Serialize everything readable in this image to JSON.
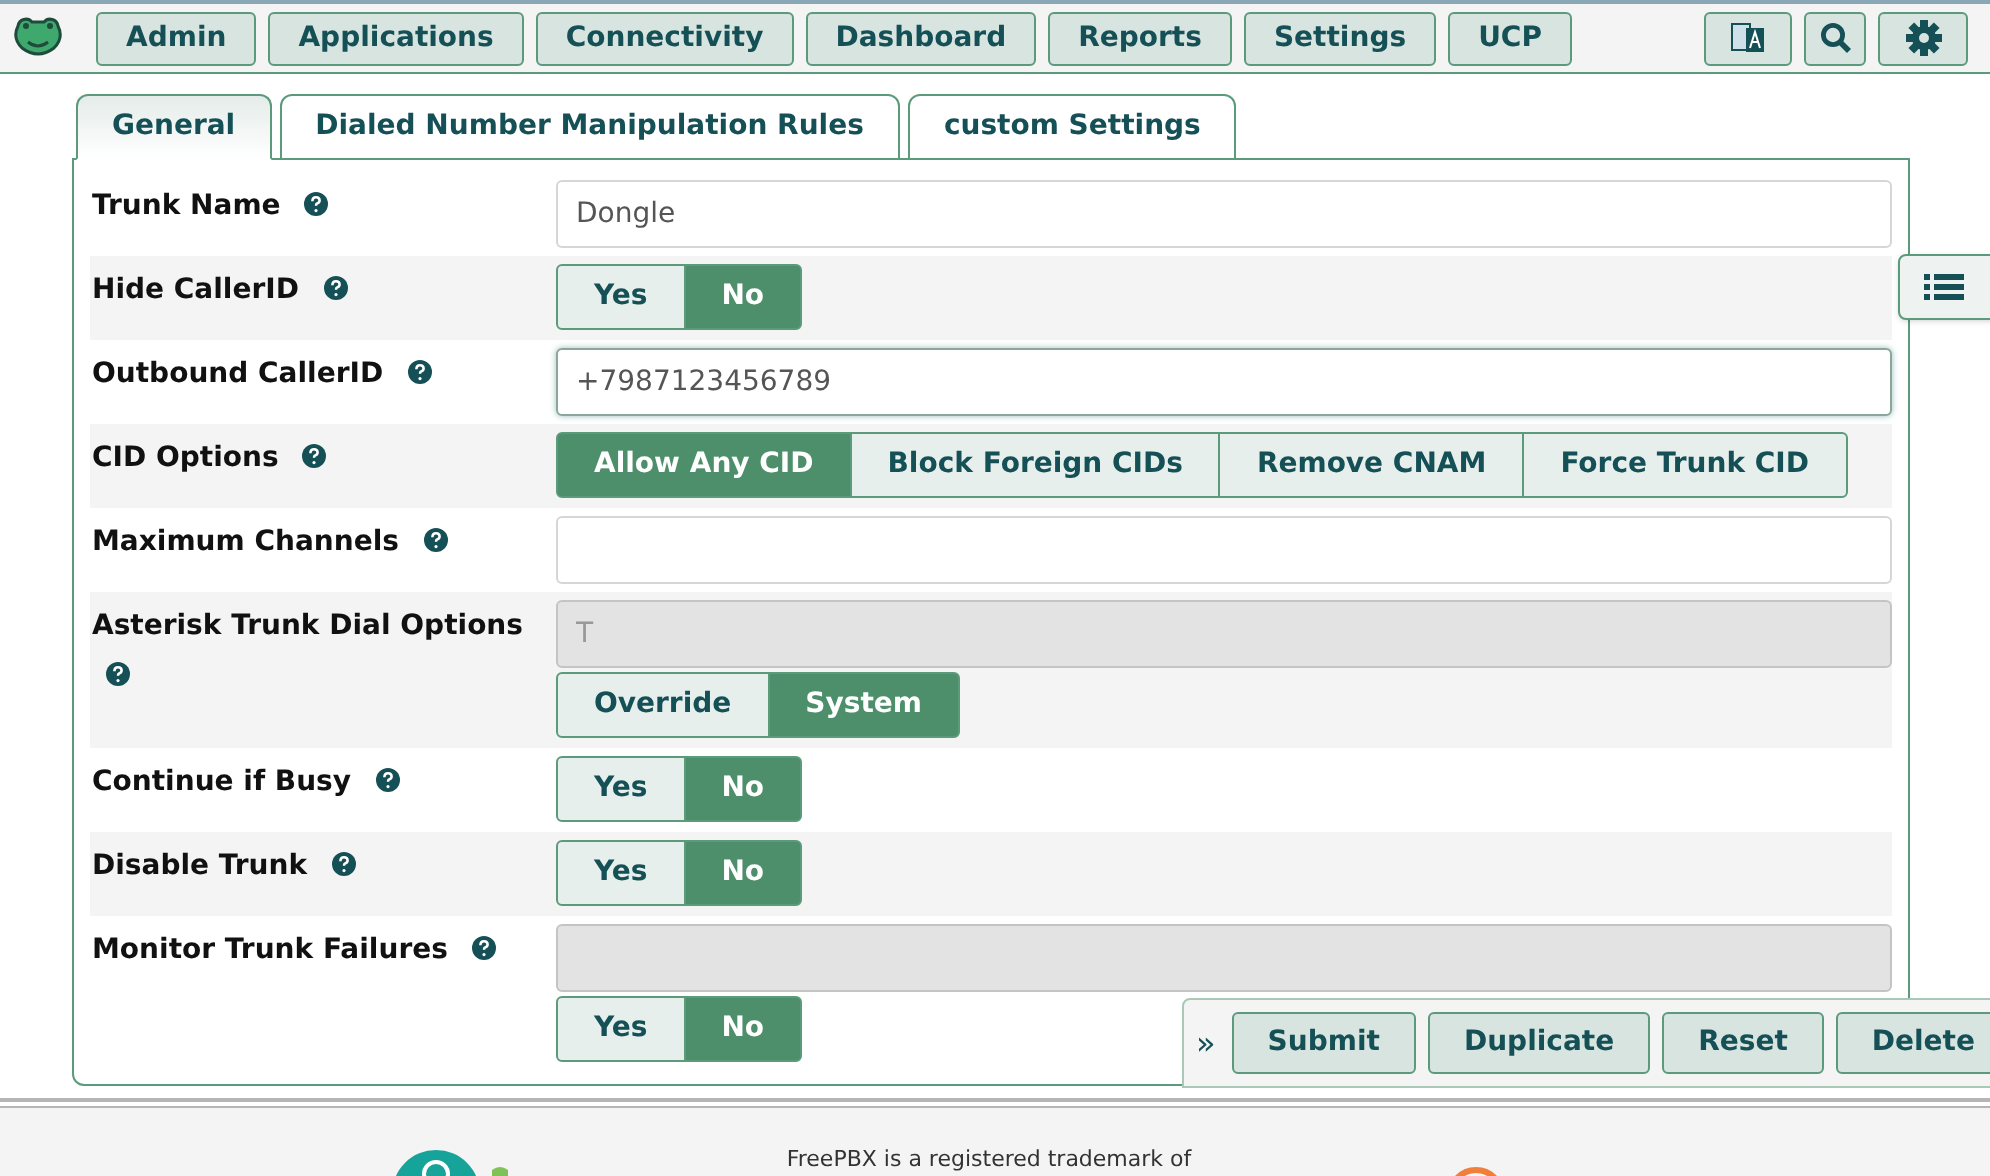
{
  "nav": {
    "items": [
      "Admin",
      "Applications",
      "Connectivity",
      "Dashboard",
      "Reports",
      "Settings",
      "UCP"
    ]
  },
  "tabs": [
    {
      "label": "General",
      "selected": true
    },
    {
      "label": "Dialed Number Manipulation Rules",
      "selected": false
    },
    {
      "label": "custom Settings",
      "selected": false
    }
  ],
  "fields": [
    {
      "label": "Trunk Name",
      "kind": "text",
      "value": "Dongle",
      "disabled": false,
      "focused": false
    },
    {
      "label": "Hide CallerID",
      "kind": "toggle",
      "options": [
        {
          "label": "Yes",
          "selected": false
        },
        {
          "label": "No",
          "selected": true
        }
      ]
    },
    {
      "label": "Outbound CallerID",
      "kind": "text",
      "value": "+7987123456789",
      "disabled": false,
      "focused": true
    },
    {
      "label": "CID Options",
      "kind": "toggle",
      "options": [
        {
          "label": "Allow Any CID",
          "selected": true
        },
        {
          "label": "Block Foreign CIDs",
          "selected": false
        },
        {
          "label": "Remove CNAM",
          "selected": false
        },
        {
          "label": "Force Trunk CID",
          "selected": false
        }
      ]
    },
    {
      "label": "Maximum Channels",
      "kind": "text",
      "disabled": false,
      "focused": false
    },
    {
      "label": "Asterisk Trunk Dial Options",
      "kind": "text_toggle",
      "value": "T",
      "disabled": true,
      "focused": false,
      "options": [
        {
          "label": "Override",
          "selected": false
        },
        {
          "label": "System",
          "selected": true
        }
      ]
    },
    {
      "label": "Continue if Busy",
      "kind": "toggle",
      "options": [
        {
          "label": "Yes",
          "selected": false
        },
        {
          "label": "No",
          "selected": true
        }
      ]
    },
    {
      "label": "Disable Trunk",
      "kind": "toggle",
      "options": [
        {
          "label": "Yes",
          "selected": false
        },
        {
          "label": "No",
          "selected": true
        }
      ]
    },
    {
      "label": "Monitor Trunk Failures",
      "kind": "text_toggle",
      "disabled": true,
      "focused": false,
      "options": [
        {
          "label": "Yes",
          "selected": false
        },
        {
          "label": "No",
          "selected": true
        }
      ]
    }
  ],
  "actions": {
    "expander": "»",
    "buttons": [
      "Submit",
      "Duplicate",
      "Reset",
      "Delete"
    ]
  },
  "footer": {
    "text": "FreePBX is a registered trademark of"
  }
}
